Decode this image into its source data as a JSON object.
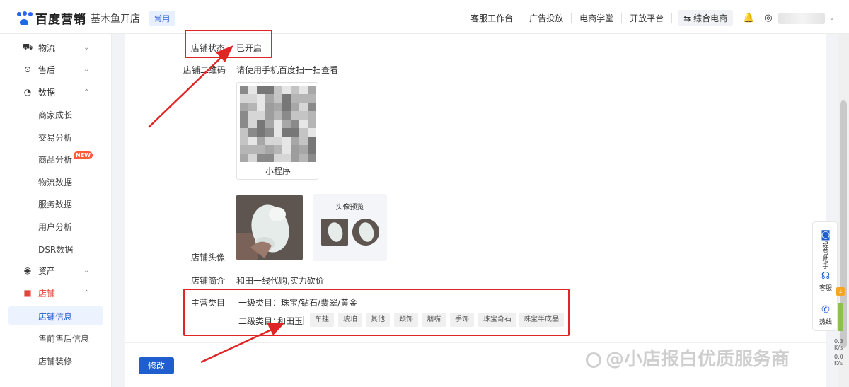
{
  "header": {
    "brand": "百度营销",
    "shop_name": "基木鱼开店",
    "tag": "常用",
    "nav": [
      "客服工作台",
      "广告投放",
      "电商学堂",
      "开放平台"
    ],
    "chip": "⇆ 综合电商"
  },
  "sidebar": {
    "groups": [
      {
        "label": "物流",
        "icon": "truck-icon",
        "state": "collapsed"
      },
      {
        "label": "售后",
        "icon": "shield-check-icon",
        "state": "collapsed"
      },
      {
        "label": "数据",
        "icon": "pie-chart-icon",
        "state": "expanded"
      }
    ],
    "data_items": [
      "商家成长",
      "交易分析",
      "商品分析",
      "物流数据",
      "服务数据",
      "用户分析",
      "DSR数据"
    ],
    "new_badge": "NEW",
    "assets": {
      "label": "资产",
      "icon": "target-icon",
      "state": "collapsed"
    },
    "store": {
      "label": "店铺",
      "icon": "store-icon",
      "state": "expanded"
    },
    "store_items": [
      "店铺信息",
      "售前售后信息",
      "店铺装修"
    ],
    "active_item": "店铺信息"
  },
  "shop_info": {
    "status_label": "店铺状态",
    "status_value": "已开启",
    "qr_label": "店铺二维码",
    "qr_hint": "请使用手机百度扫一扫查看",
    "qr_caption": "小程序",
    "avatar_label": "店铺头像",
    "preview_title": "头像预览",
    "intro_label": "店铺简介",
    "intro_value": "和田一线代购,实力砍价",
    "category_label": "主营类目",
    "primary_category": "一级类目：珠宝/钻石/翡翠/黄金",
    "secondary_prefix": "二级类目：",
    "secondary_selected": "和田玉",
    "secondary_sep": "|",
    "secondary_options": [
      "车挂",
      "琥珀",
      "其他",
      "颈饰",
      "烟嘴",
      "手饰",
      "珠宝奇石",
      "珠宝半成品"
    ]
  },
  "footer": {
    "modify_label": "修改"
  },
  "float_panel": [
    {
      "label": "经营助手",
      "icon": "robot-icon"
    },
    {
      "label": "客服",
      "icon": "headset-icon"
    },
    {
      "label": "热线",
      "icon": "phone-icon"
    }
  ],
  "net_meter": {
    "badge": "1",
    "lines": [
      "0.3",
      "K/s",
      "0.0",
      "K/s"
    ]
  },
  "watermark": "@小店报白优质服务商",
  "colors": {
    "accent": "#1f5ecf",
    "annotation": "#e02525",
    "badge": "#ff5a3c"
  }
}
